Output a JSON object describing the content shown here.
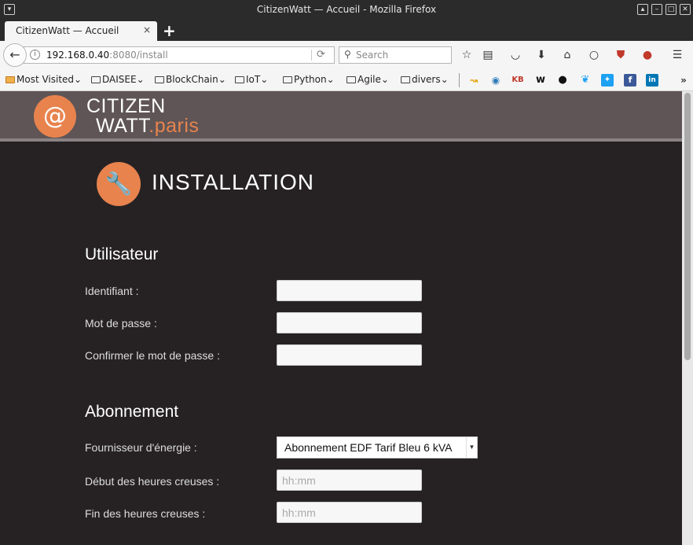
{
  "window": {
    "title": "CitizenWatt — Accueil - Mozilla Firefox"
  },
  "tab": {
    "title": "CitizenWatt — Accueil",
    "close": "×",
    "new": "+"
  },
  "nav": {
    "url_host": "192.168.0.40",
    "url_path": ":8080/install",
    "search_placeholder": "Search"
  },
  "bookmarks": [
    {
      "label": "Most Visited"
    },
    {
      "label": "DAISEE"
    },
    {
      "label": "BlockChain"
    },
    {
      "label": "IoT"
    },
    {
      "label": "Python"
    },
    {
      "label": "Agile"
    },
    {
      "label": "divers"
    }
  ],
  "bookmark_icons": {
    "kb": "KB",
    "w": "w"
  },
  "header": {
    "logo_line1": "CITIZEN",
    "logo_line2": "WATT",
    "logo_suffix": ".paris"
  },
  "page": {
    "title": "INSTALLATION"
  },
  "user_section": {
    "title": "Utilisateur",
    "username_label": "Identifiant :",
    "password_label": "Mot de passe :",
    "confirm_label": "Confirmer le mot de passe :"
  },
  "subscription_section": {
    "title": "Abonnement",
    "provider_label": "Fournisseur d'énergie :",
    "provider_value": "Abonnement EDF Tarif Bleu 6 kVA",
    "offpeak_start_label": "Début des heures creuses :",
    "offpeak_start_placeholder": "hh:mm",
    "offpeak_end_label": "Fin des heures creuses :",
    "offpeak_end_placeholder": "hh:mm"
  },
  "colors": {
    "accent": "#e8834e",
    "background": "#262223",
    "header": "#5f5556"
  }
}
